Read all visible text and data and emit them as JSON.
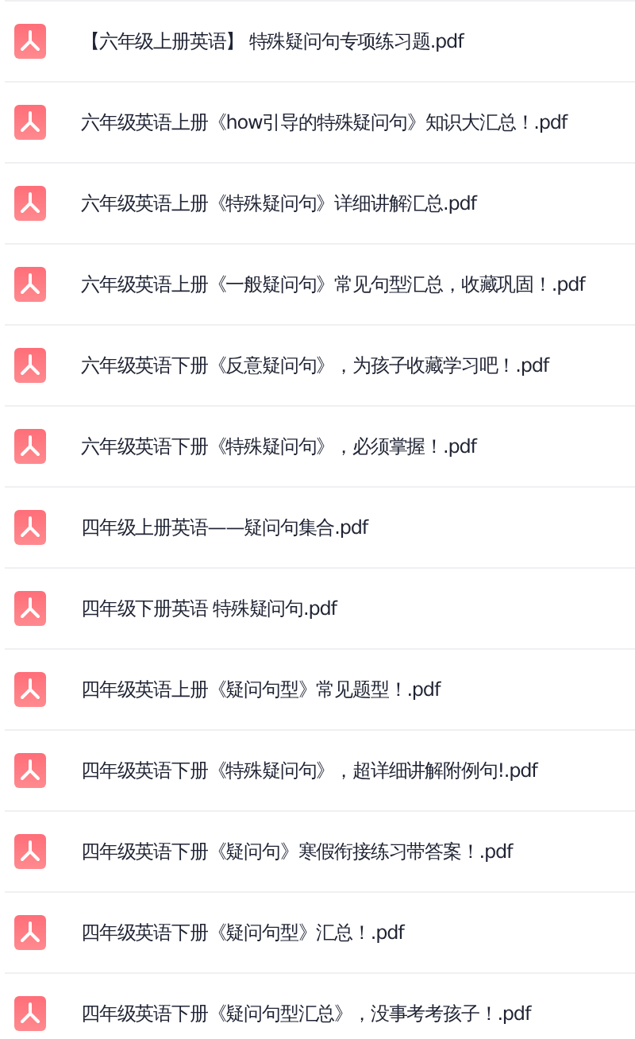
{
  "files": [
    {
      "name": "【六年级上册英语】 特殊疑问句专项练习题.pdf"
    },
    {
      "name": "六年级英语上册《how引导的特殊疑问句》知识大汇总！.pdf"
    },
    {
      "name": "六年级英语上册《特殊疑问句》详细讲解汇总.pdf"
    },
    {
      "name": "六年级英语上册《一般疑问句》常见句型汇总，收藏巩固！.pdf"
    },
    {
      "name": "六年级英语下册《反意疑问句》，为孩子收藏学习吧！.pdf"
    },
    {
      "name": "六年级英语下册《特殊疑问句》，必须掌握！.pdf"
    },
    {
      "name": "四年级上册英语——疑问句集合.pdf"
    },
    {
      "name": "四年级下册英语 特殊疑问句.pdf"
    },
    {
      "name": "四年级英语上册《疑问句型》常见题型！.pdf"
    },
    {
      "name": "四年级英语下册《特殊疑问句》，超详细讲解附例句!.pdf"
    },
    {
      "name": "四年级英语下册《疑问句》寒假衔接练习带答案！.pdf"
    },
    {
      "name": "四年级英语下册《疑问句型》汇总！.pdf"
    },
    {
      "name": "四年级英语下册《疑问句型汇总》，没事考考孩子！.pdf"
    }
  ]
}
